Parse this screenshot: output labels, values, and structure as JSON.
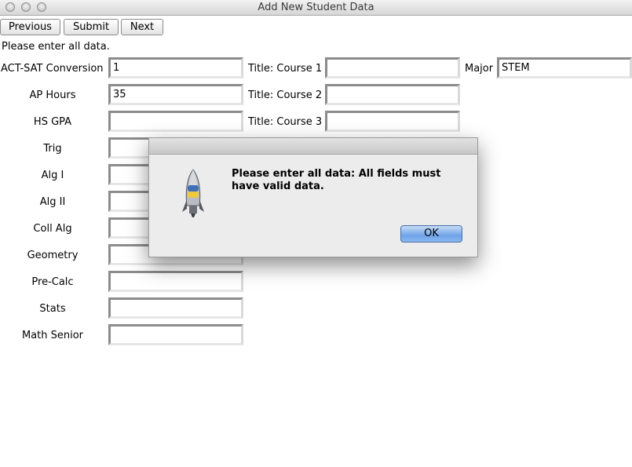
{
  "window": {
    "title": "Add New Student Data"
  },
  "toolbar": {
    "previous": "Previous",
    "submit": "Submit",
    "next": "Next"
  },
  "prompt": "Please enter all data.",
  "form": {
    "left": [
      {
        "label": "ACT-SAT Conversion",
        "value": "1"
      },
      {
        "label": "AP Hours",
        "value": "35"
      },
      {
        "label": "HS GPA",
        "value": ""
      },
      {
        "label": "Trig",
        "value": ""
      },
      {
        "label": "Alg I",
        "value": ""
      },
      {
        "label": "Alg II",
        "value": ""
      },
      {
        "label": "Coll Alg",
        "value": ""
      },
      {
        "label": "Geometry",
        "value": ""
      },
      {
        "label": "Pre-Calc",
        "value": ""
      },
      {
        "label": "Stats",
        "value": ""
      },
      {
        "label": "Math Senior",
        "value": ""
      }
    ],
    "middle": [
      {
        "label": "Title: Course 1",
        "value": ""
      },
      {
        "label": "Title: Course 2",
        "value": ""
      },
      {
        "label": "Title: Course 3",
        "value": ""
      }
    ],
    "right": {
      "label": "Major",
      "value": "STEM"
    }
  },
  "dialog": {
    "message": "Please enter all data: All fields must have valid data.",
    "ok_label": "OK",
    "icon": "python-rocket-icon"
  }
}
